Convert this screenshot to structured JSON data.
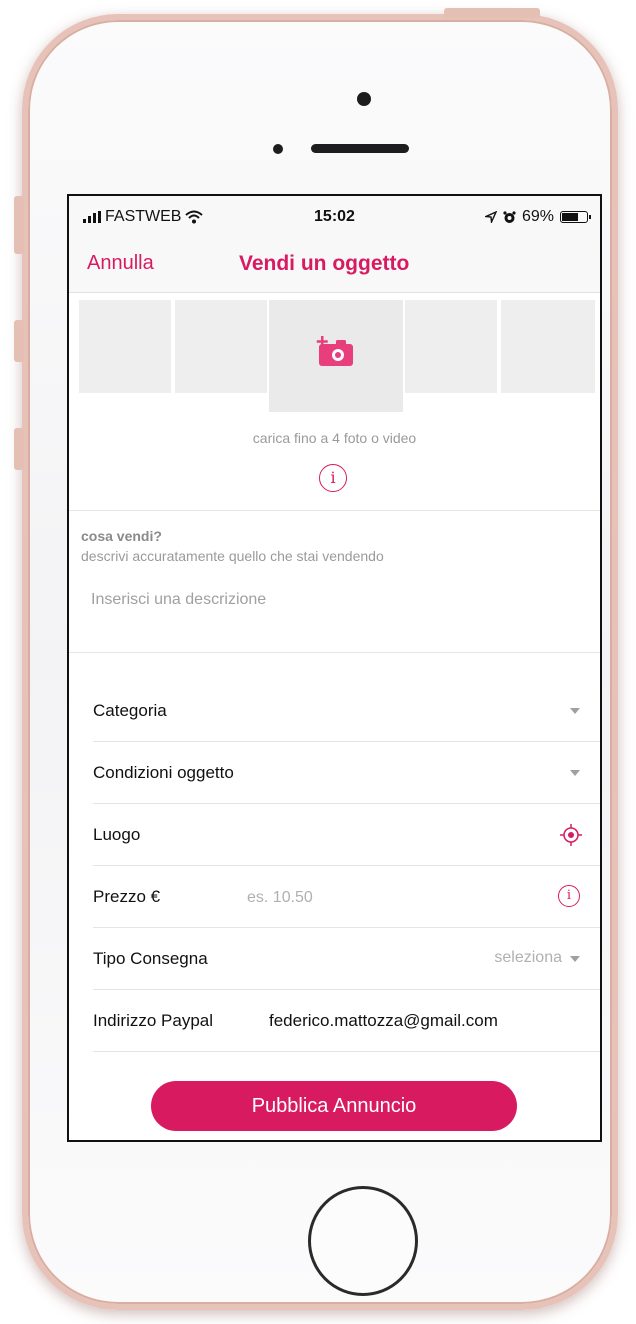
{
  "status_bar": {
    "carrier": "FASTWEB",
    "time": "15:02",
    "battery": "69%",
    "battery_level": 0.69
  },
  "nav": {
    "cancel_label": "Annulla",
    "title": "Vendi un oggetto"
  },
  "photos": {
    "hint": "carica fino a 4 foto o video",
    "info_glyph": "i"
  },
  "description": {
    "title": "cosa vendi?",
    "subtitle": "descrivi accuratamente quello che stai vendendo",
    "placeholder": "Inserisci una descrizione"
  },
  "form": {
    "category_label": "Categoria",
    "condition_label": "Condizioni oggetto",
    "location_label": "Luogo",
    "price_label": "Prezzo €",
    "price_placeholder": "es. 10.50",
    "delivery_label": "Tipo Consegna",
    "delivery_value": "seleziona",
    "paypal_label": "Indirizzo Paypal",
    "paypal_value": "federico.mattozza@gmail.com",
    "info_glyph": "i"
  },
  "publish_label": "Pubblica Annuncio",
  "colors": {
    "accent": "#d81b60",
    "frame": "#e7c2b8"
  }
}
